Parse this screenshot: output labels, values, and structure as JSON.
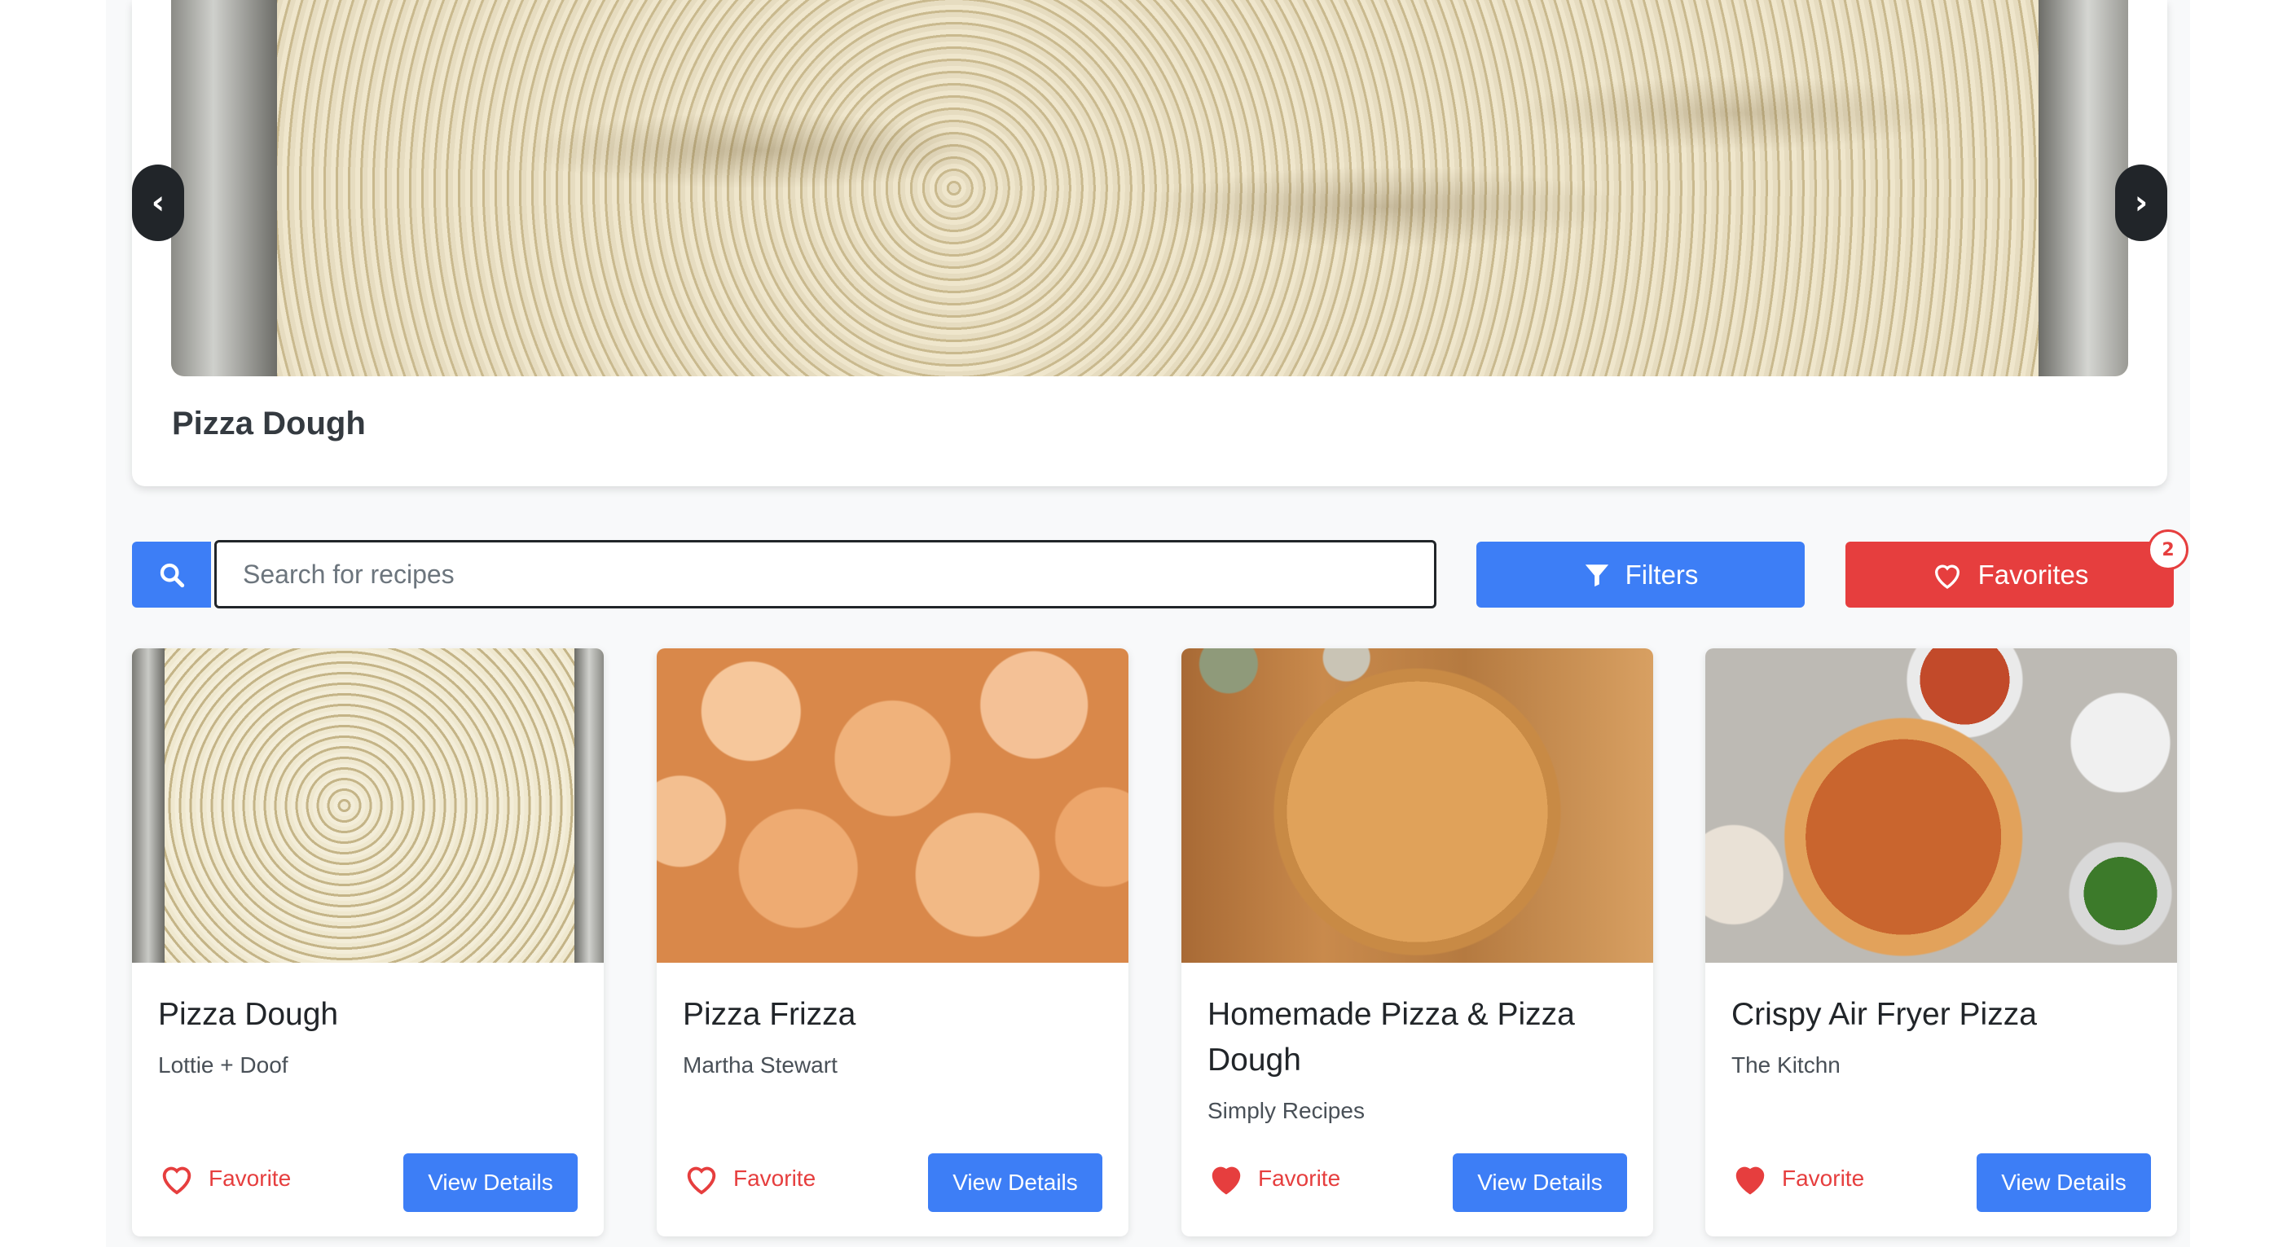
{
  "carousel": {
    "prev_icon": "chevron-left",
    "next_icon": "chevron-right",
    "prev_glyph": "‹",
    "next_glyph": "›",
    "title": "Pizza Dough"
  },
  "toolbar": {
    "search_icon": "search",
    "search_placeholder": "Search for recipes",
    "search_value": "",
    "filters_label": "Filters",
    "filters_icon": "filter",
    "favorites_label": "Favorites",
    "favorites_icon": "heart-outline",
    "favorites_count": "2"
  },
  "recipes": [
    {
      "title": "Pizza Dough",
      "source": "Lottie + Doof",
      "favorite_label": "Favorite",
      "favorited": false,
      "view_label": "View Details"
    },
    {
      "title": "Pizza Frizza",
      "source": "Martha Stewart",
      "favorite_label": "Favorite",
      "favorited": false,
      "view_label": "View Details"
    },
    {
      "title": "Homemade Pizza & Pizza Dough",
      "source": "Simply Recipes",
      "favorite_label": "Favorite",
      "favorited": true,
      "view_label": "View Details"
    },
    {
      "title": "Crispy Air Fryer Pizza",
      "source": "The Kitchn",
      "favorite_label": "Favorite",
      "favorited": true,
      "view_label": "View Details"
    }
  ],
  "colors": {
    "primary": "#3d7ef6",
    "danger": "#e63e3e",
    "dark": "#212529"
  }
}
